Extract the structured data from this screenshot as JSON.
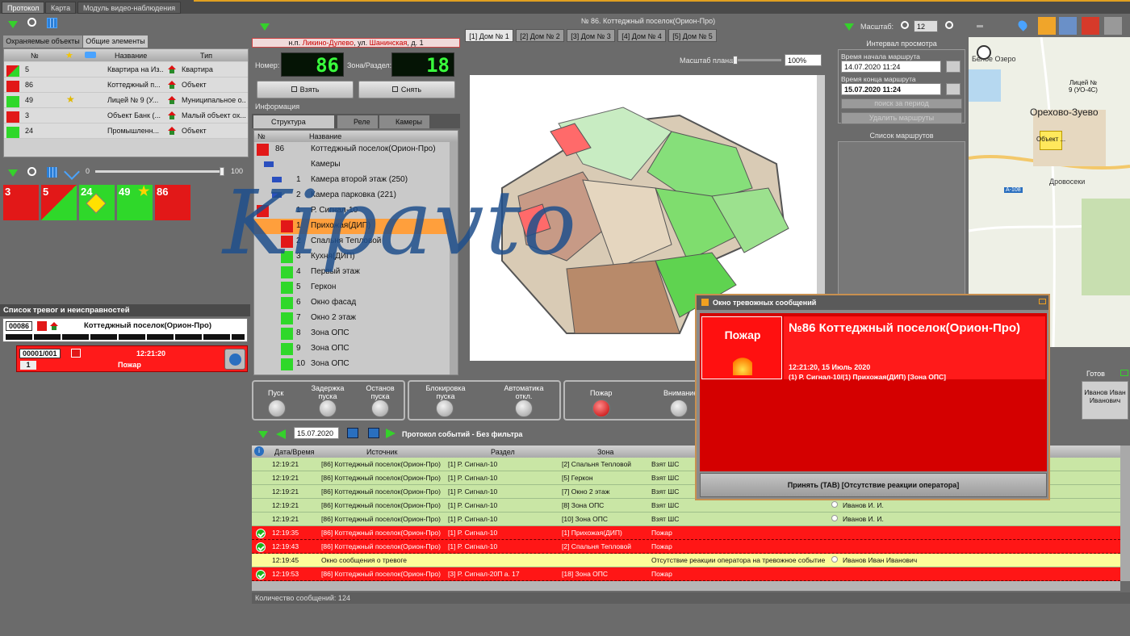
{
  "tabs": [
    "Протокол",
    "Карта",
    "Модуль видео-наблюдения"
  ],
  "left": {
    "subtabs": [
      "Охраняемые объекты",
      "Общие элементы"
    ],
    "columns": [
      "№",
      "Название",
      "Тип"
    ],
    "objects": [
      {
        "num": "5",
        "name": "Квартира на Из...",
        "type": "Квартира"
      },
      {
        "num": "86",
        "name": "Коттеджный п...",
        "type": "Объект"
      },
      {
        "num": "49",
        "name": "Лицей № 9 (У...",
        "type": "Муниципальное о..."
      },
      {
        "num": "3",
        "name": "Объект Банк (...",
        "type": "Малый объект ох..."
      },
      {
        "num": "24",
        "name": "Промышленн...",
        "type": "Объект"
      }
    ],
    "slider_min": "0",
    "slider_max": "100",
    "slider_value": 100,
    "tiles": [
      "3",
      "5",
      "24",
      "49",
      "86"
    ],
    "alarms_title": "Список тревог и неисправностей",
    "alarm_obj_num": "00086",
    "alarm_obj_name": "Коттеджный поселок(Орион-Про)",
    "alarm_code": "00001/001",
    "alarm_time": "12:21:20",
    "alarm_count": "1",
    "alarm_event": "Пожар"
  },
  "mid": {
    "address_prefix": "н.п. ",
    "address_city": "Ликино-Дулево",
    "address_rest": ", ул. ",
    "address_street": "Шанинская",
    "address_house": ", д. 1",
    "number_label": "Номер:",
    "number_value": "86",
    "zone_label": "Зона/Раздел:",
    "zone_value": "18",
    "take_label": "Взять",
    "remove_label": "Снять",
    "info_label": "Информация",
    "subtabs": [
      "Структура объекта",
      "Реле",
      "Камеры"
    ],
    "tree_cols": [
      "№",
      "Название"
    ],
    "tree": [
      {
        "num": "86",
        "name": "Коттеджный поселок(Орион-Про)",
        "kind": "red"
      },
      {
        "num": "",
        "name": "Камеры",
        "kind": "cam"
      },
      {
        "num": "1",
        "name": "Камера второй этаж (250)",
        "kind": "camitem"
      },
      {
        "num": "2",
        "name": "Камера парковка (221)",
        "kind": "camitem"
      },
      {
        "num": "1",
        "name": "Р. Сигнал-10",
        "kind": "red"
      },
      {
        "num": "1",
        "name": "Прихожая(ДИП)",
        "kind": "sel"
      },
      {
        "num": "2",
        "name": "Спальня Тепловой",
        "kind": "red"
      },
      {
        "num": "3",
        "name": "Кухня(ДИП)",
        "kind": "grn"
      },
      {
        "num": "4",
        "name": "Первый этаж",
        "kind": "grn"
      },
      {
        "num": "5",
        "name": "Геркон",
        "kind": "grn"
      },
      {
        "num": "6",
        "name": "Окно фасад",
        "kind": "grn"
      },
      {
        "num": "7",
        "name": "Окно 2 этаж",
        "kind": "grn"
      },
      {
        "num": "8",
        "name": "Зона ОПС",
        "kind": "grn"
      },
      {
        "num": "9",
        "name": "Зона ОПС",
        "kind": "grn"
      },
      {
        "num": "10",
        "name": "Зона ОПС",
        "kind": "grn"
      }
    ],
    "plan_title": "№ 86. Коттеджный поселок(Орион-Про)",
    "plan_tabs": [
      "[1] Дом № 1",
      "[2] Дом № 2",
      "[3] Дом № 3",
      "[4] Дом № 4",
      "[5] Дом № 5"
    ],
    "scale_label": "Масштаб плана",
    "scale_value": "100%",
    "ctrl": [
      "Пуск",
      "Задержка пуска",
      "Останов пуска",
      "Блокировка пуска",
      "Автоматика откл.",
      "Пожар",
      "Внимание"
    ]
  },
  "log": {
    "date": "15.07.2020",
    "title": "Протокол событий - Без фильтра",
    "columns": [
      "Дата/Время",
      "Источник",
      "Раздел",
      "Зона"
    ],
    "rows": [
      {
        "t": "12:19:21",
        "src": "[86] Коттеджный поселок(Орион-Про)",
        "sec": "[1] Р. Сигнал-10",
        "zone": "[2] Спальня Тепловой",
        "ev": "Взят ШС",
        "op": "",
        "k": "g"
      },
      {
        "t": "12:19:21",
        "src": "[86] Коттеджный поселок(Орион-Про)",
        "sec": "[1] Р. Сигнал-10",
        "zone": "[5] Геркон",
        "ev": "Взят ШС",
        "op": "",
        "k": "g"
      },
      {
        "t": "12:19:21",
        "src": "[86] Коттеджный поселок(Орион-Про)",
        "sec": "[1] Р. Сигнал-10",
        "zone": "[7] Окно 2 этаж",
        "ev": "Взят ШС",
        "op": "",
        "k": "g"
      },
      {
        "t": "12:19:21",
        "src": "[86] Коттеджный поселок(Орион-Про)",
        "sec": "[1] Р. Сигнал-10",
        "zone": "[8] Зона ОПС",
        "ev": "Взят ШС",
        "op": "Иванов И. И.",
        "k": "g"
      },
      {
        "t": "12:19:21",
        "src": "[86] Коттеджный поселок(Орион-Про)",
        "sec": "[1] Р. Сигнал-10",
        "zone": "[10] Зона ОПС",
        "ev": "Взят ШС",
        "op": "Иванов И. И.",
        "k": "g"
      },
      {
        "t": "12:19:35",
        "src": "[86] Коттеджный поселок(Орион-Про)",
        "sec": "[1] Р. Сигнал-10",
        "zone": "[1] Прихожая(ДИП)",
        "ev": "Пожар",
        "op": "",
        "k": "r"
      },
      {
        "t": "12:19:43",
        "src": "[86] Коттеджный поселок(Орион-Про)",
        "sec": "[1] Р. Сигнал-10",
        "zone": "[2] Спальня Тепловой",
        "ev": "Пожар",
        "op": "",
        "k": "r"
      },
      {
        "t": "12:19:45",
        "src": "Окно сообщения о тревоге",
        "sec": "",
        "zone": "",
        "ev": "Отсутствие реакции оператора на тревожное событие",
        "op": "Иванов Иван Иванович",
        "k": "y"
      },
      {
        "t": "12:19:53",
        "src": "[86] Коттеджный поселок(Орион-Про)",
        "sec": "[3] Р. Сигнал-20П а. 17",
        "zone": "[18] Зона ОПС",
        "ev": "Пожар",
        "op": "",
        "k": "r"
      }
    ],
    "count_label": "Количество сообщений: 124"
  },
  "right": {
    "scale_label": "Масштаб:",
    "scale_value": "12",
    "interval_title": "Интервал просмотра",
    "start_label": "Время начала маршрута",
    "start_value": "14.07.2020 11:24",
    "end_label": "Время конца маршрута",
    "end_value": "15.07.2020 11:24",
    "search_label": "поиск за период",
    "delete_label": "Удалить маршруты",
    "routes_title": "Список маршрутов",
    "ready_label": "Готов",
    "operator": "Иванов Иван Иванович",
    "map_labels": [
      "Белое Озеро",
      "Лицей № 9 (УО-4С)",
      "Орехово-Зуево",
      "Объект ...",
      "А-108",
      "Дровосеки"
    ]
  },
  "alarm_win": {
    "title": "Окно тревожных сообщений",
    "type": "Пожар",
    "heading": "№86 Коттеджный поселок(Орион-Про)",
    "datetime": "12:21:20, 15 Июль 2020",
    "detail": "(1) Р. Сигнал-10/(1) Прихожая(ДИП) [Зона ОПС]",
    "accept": "Принять (TAB) [Отсутствие реакции оператора]"
  },
  "watermark": "Kipavto"
}
